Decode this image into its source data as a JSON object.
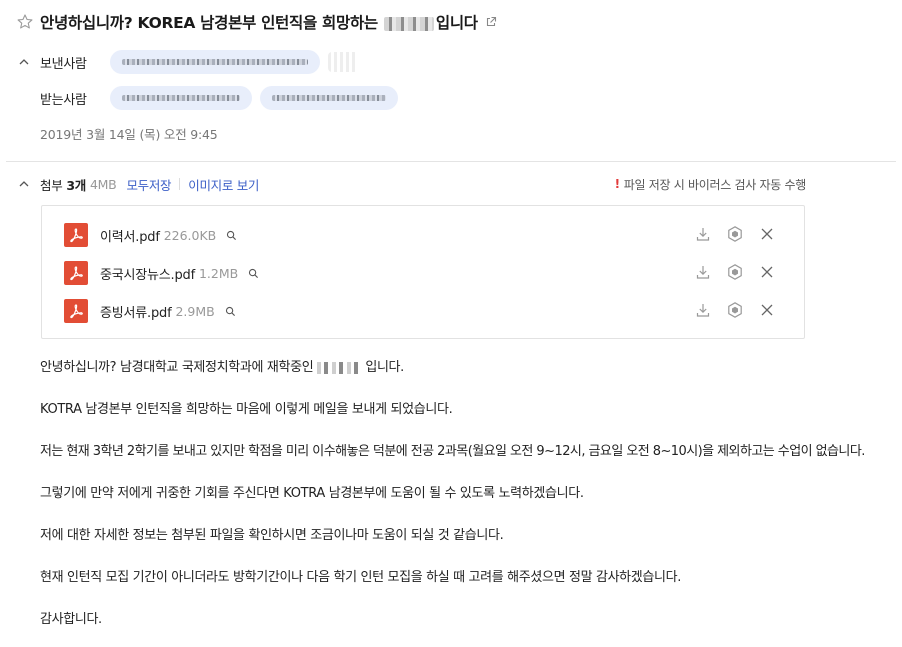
{
  "subject": {
    "text_before": "안녕하십니까? KOREA 남경본부 인턴직을 희망하는",
    "text_after": "입니다"
  },
  "sender": {
    "label": "보낸사람"
  },
  "receiver": {
    "label": "받는사람"
  },
  "date": "2019년 3월 14일 (목) 오전 9:45",
  "attachments": {
    "title": "첨부",
    "count": "3개",
    "total_size": "4MB",
    "save_all_label": "모두저장",
    "view_as_image_label": "이미지로 보기",
    "virus_note": "파일 저장 시 바이러스 검사 자동 수행",
    "files": [
      {
        "name": "이력서.pdf",
        "size": "226.0KB"
      },
      {
        "name": "중국시장뉴스.pdf",
        "size": "1.2MB"
      },
      {
        "name": "증빙서류.pdf",
        "size": "2.9MB"
      }
    ]
  },
  "body": {
    "p1_before": "안녕하십니까? 남경대학교 국제정치학과에 재학중인",
    "p1_after": "입니다.",
    "p2": "KOTRA 남경본부 인턴직을 희망하는 마음에 이렇게 메일을 보내게 되었습니다.",
    "p3": "저는 현재 3학년 2학기를 보내고 있지만 학점을 미리 이수해놓은 덕분에 전공 2과목(월요일 오전 9~12시, 금요일 오전 8~10시)을 제외하고는 수업이 없습니다.",
    "p4": "그렇기에 만약 저에게 귀중한 기회를 주신다면 KOTRA 남경본부에 도움이 될 수 있도록 노력하겠습니다.",
    "p5": "저에 대한 자세한 정보는 첨부된 파일을 확인하시면 조금이나마 도움이 되실 것 같습니다.",
    "p6": "현재 인턴직 모집 기간이 아니더라도 방학기간이나 다음 학기 인턴 모집을 하실 때 고려를 해주셨으면 정말 감사하겠습니다.",
    "p7": "감사합니다."
  },
  "icons": {
    "star": "star-outline-icon",
    "external": "external-link-icon",
    "collapse": "chevron-up-icon",
    "pdf": "pdf-file-icon",
    "preview": "magnifier-icon",
    "download": "download-icon",
    "cloud_save": "hexagon-save-icon",
    "delete": "close-icon"
  },
  "colors": {
    "link": "#3c5fc7",
    "pdf": "#e24d35",
    "warning": "#e23b3b",
    "chip": "#e8eefb"
  }
}
